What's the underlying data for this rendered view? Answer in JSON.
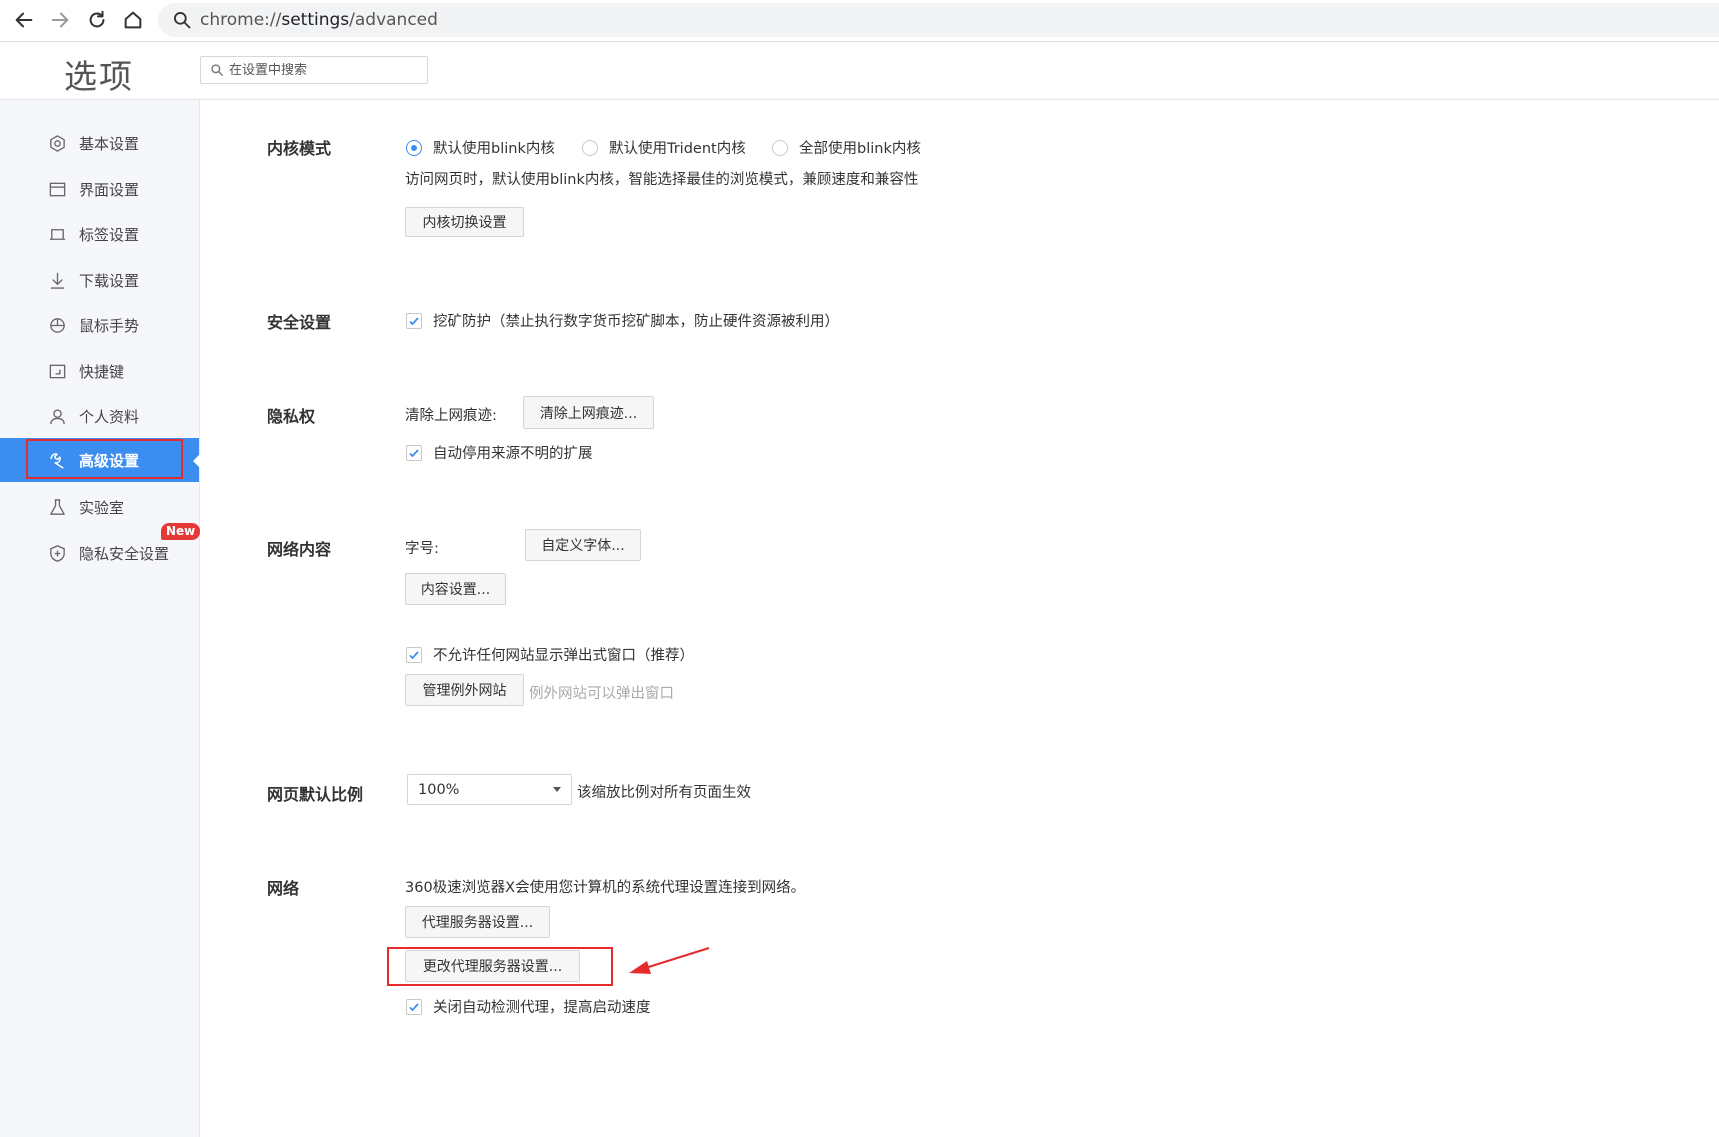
{
  "browser": {
    "url_scheme": "chrome://",
    "url_host": "settings",
    "url_path": "/advanced",
    "icons": [
      "back-icon",
      "forward-icon",
      "reload-icon",
      "home-icon",
      "search-icon"
    ]
  },
  "header": {
    "title": "选项",
    "search_placeholder": "在设置中搜索"
  },
  "sidebar": {
    "items": [
      {
        "label": "基本设置",
        "icon": "basic-settings-icon"
      },
      {
        "label": "界面设置",
        "icon": "interface-icon"
      },
      {
        "label": "标签设置",
        "icon": "tab-icon"
      },
      {
        "label": "下载设置",
        "icon": "download-icon"
      },
      {
        "label": "鼠标手势",
        "icon": "mouse-icon"
      },
      {
        "label": "快捷键",
        "icon": "shortcut-icon"
      },
      {
        "label": "个人资料",
        "icon": "profile-icon"
      },
      {
        "label": "高级设置",
        "icon": "wrench-icon",
        "active": true
      },
      {
        "label": "实验室",
        "icon": "flask-icon"
      },
      {
        "label": "隐私安全设置",
        "icon": "shield-icon"
      }
    ],
    "new_badge": "New"
  },
  "content": {
    "kernel": {
      "title": "内核模式",
      "options": [
        "默认使用blink内核",
        "默认使用Trident内核",
        "全部使用blink内核"
      ],
      "selected_index": 0,
      "description": "访问网页时，默认使用blink内核，智能选择最佳的浏览模式，兼顾速度和兼容性",
      "button": "内核切换设置"
    },
    "security": {
      "title": "安全设置",
      "mining_protection": "挖矿防护（禁止执行数字货币挖矿脚本，防止硬件资源被利用）"
    },
    "privacy": {
      "title": "隐私权",
      "clear_label": "清除上网痕迹:",
      "clear_button": "清除上网痕迹...",
      "disable_unknown_ext": "自动停用来源不明的扩展"
    },
    "web_content": {
      "title": "网络内容",
      "font_label": "字号:",
      "font_button": "自定义字体...",
      "content_button": "内容设置...",
      "block_popups": "不允许任何网站显示弹出式窗口（推荐）",
      "exceptions_button": "管理例外网站",
      "exceptions_hint": "例外网站可以弹出窗口"
    },
    "zoom": {
      "title": "网页默认比例",
      "value": "100%",
      "hint": "该缩放比例对所有页面生效"
    },
    "network": {
      "title": "网络",
      "description": "360极速浏览器X会使用您计算机的系统代理设置连接到网络。",
      "proxy_button": "代理服务器设置...",
      "change_proxy_button": "更改代理服务器设置...",
      "disable_auto_detect": "关闭自动检测代理，提高启动速度"
    }
  },
  "colors": {
    "accent": "#3b8ef0",
    "annotation_red": "#e52b2b",
    "sidebar_bg": "#f5f7fa"
  }
}
